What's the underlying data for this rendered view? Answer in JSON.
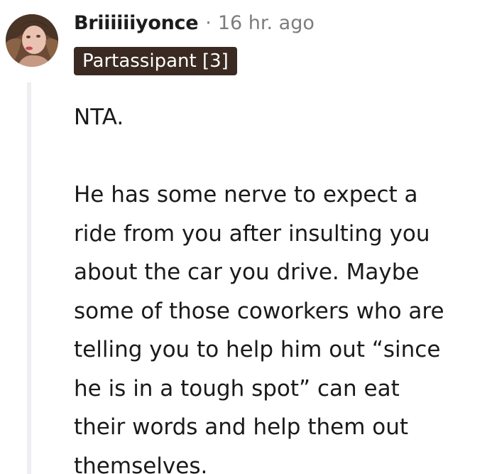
{
  "comment": {
    "author": "Briiiiiiyonce",
    "separator": "·",
    "timestamp": "16 hr. ago",
    "flair": "Partassipant [3]",
    "verdict": "NTA.",
    "lines": [
      "He has some nerve to expect a",
      "ride from you after insulting you",
      "about the car you drive. Maybe",
      "some of those coworkers who are",
      "telling you to help him out “since",
      "he is in a tough spot” can eat",
      "their words and help them out",
      "themselves."
    ]
  },
  "colors": {
    "flair_background": "#3a2a21",
    "muted_text": "#7c7c7c",
    "thread_line": "#edeff1"
  }
}
